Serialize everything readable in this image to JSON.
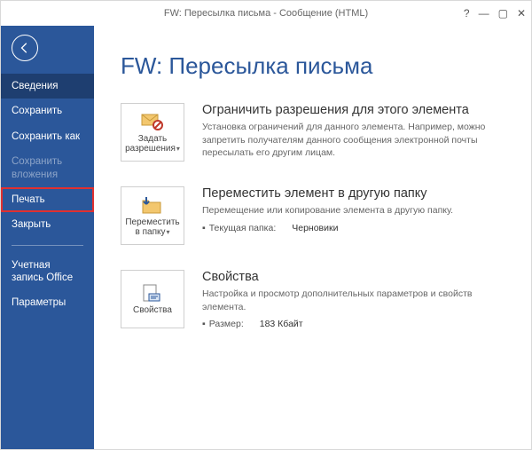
{
  "window": {
    "title": "FW: Пересылка письма - Сообщение (HTML)"
  },
  "sidebar": {
    "items": [
      {
        "label": "Сведения"
      },
      {
        "label": "Сохранить"
      },
      {
        "label": "Сохранить как"
      },
      {
        "label": "Сохранить вложения"
      },
      {
        "label": "Печать"
      },
      {
        "label": "Закрыть"
      }
    ],
    "bottom": [
      {
        "label": "Учетная запись Office"
      },
      {
        "label": "Параметры"
      }
    ]
  },
  "page": {
    "title": "FW: Пересылка письма",
    "sections": {
      "permissions": {
        "tile_label": "Задать разрешения",
        "title": "Ограничить разрешения для этого элемента",
        "desc": "Установка ограничений для данного элемента. Например, можно запретить получателям данного сообщения электронной почты пересылать его другим лицам."
      },
      "move": {
        "tile_label": "Переместить в папку",
        "title": "Переместить элемент в другую папку",
        "desc": "Перемещение или копирование элемента в другую папку.",
        "folder_key": "Текущая папка:",
        "folder_val": "Черновики"
      },
      "props": {
        "tile_label": "Свойства",
        "title": "Свойства",
        "desc": "Настройка и просмотр дополнительных параметров и свойств элемента.",
        "size_key": "Размер:",
        "size_val": "183 Кбайт"
      }
    }
  }
}
